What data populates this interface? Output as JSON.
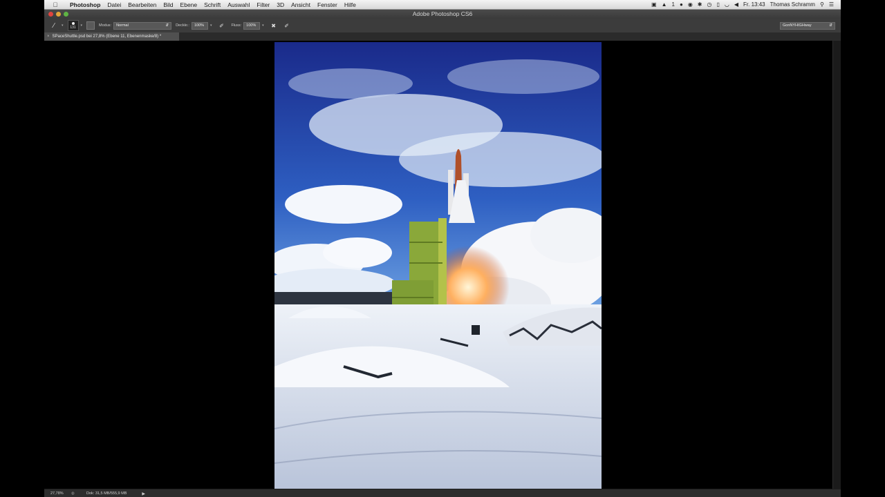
{
  "menubar": {
    "apple_icon": "apple-logo-icon",
    "app_name": "Photoshop",
    "items": [
      "Datei",
      "Bearbeiten",
      "Bild",
      "Ebene",
      "Schrift",
      "Auswahl",
      "Filter",
      "3D",
      "Ansicht",
      "Fenster",
      "Hilfe"
    ],
    "clock": "Fr. 13:43",
    "user": "Thomas Schramm",
    "tray_count": "1"
  },
  "window": {
    "title": "Adobe Photoshop CS6"
  },
  "options": {
    "brush_size": "131",
    "mode_label": "Modus:",
    "mode_value": "Normal",
    "opacity_label": "Deckkr.:",
    "opacity_value": "100%",
    "flow_label": "Fluss:",
    "flow_value": "100%",
    "workspace_value": "GonNYHIGHway"
  },
  "document": {
    "tab_close": "×",
    "tab_title": "SPaceShuttle.psd bei 27,8% (Ebene 11, Ebenenmaske/8) *"
  },
  "status": {
    "zoom": "27,78%",
    "doc_info": "Dok: 31,5 MB/555,9 MB",
    "arrow": "▶"
  },
  "colors": {
    "ui_dark": "#3c3c3c",
    "accent_close": "#e0443e",
    "accent_min": "#e1a53a",
    "accent_max": "#5fb344"
  }
}
